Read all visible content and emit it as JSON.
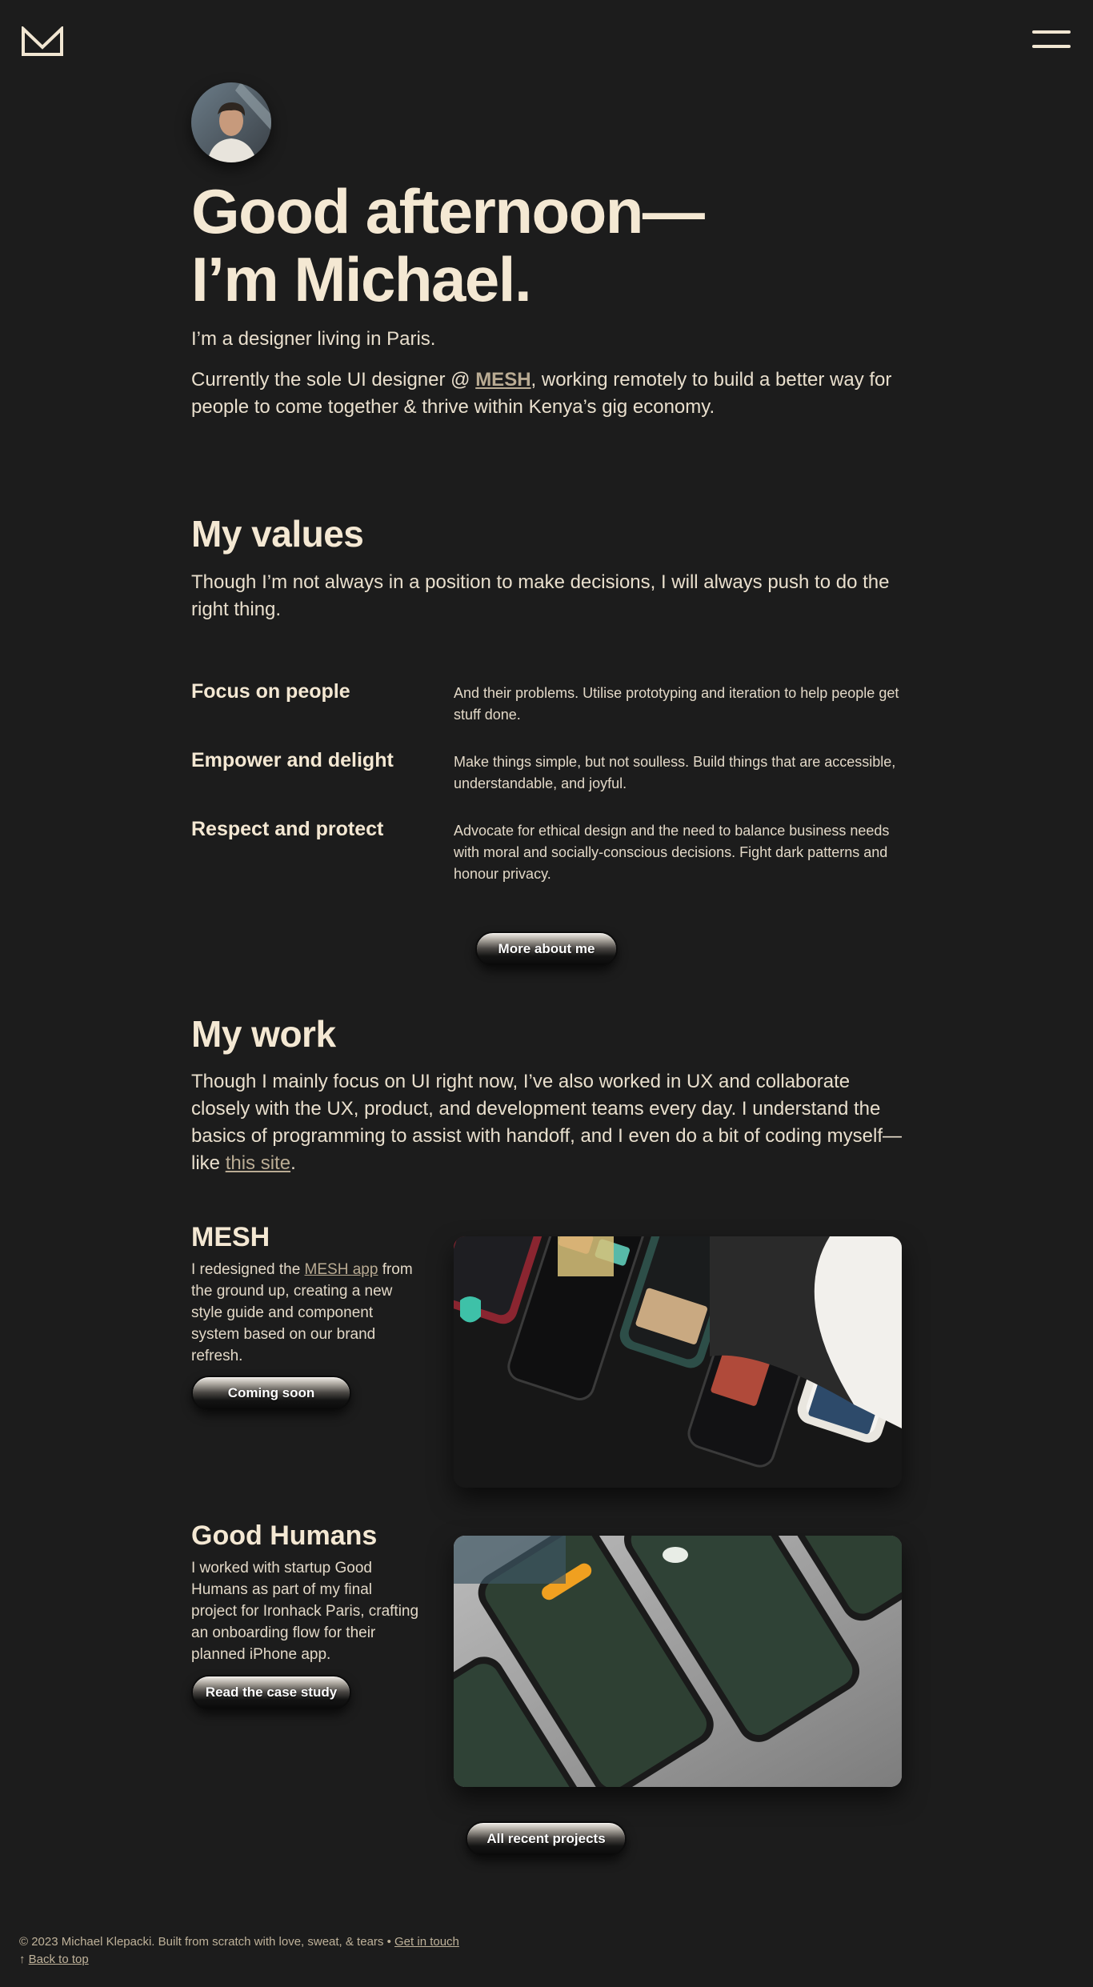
{
  "header": {
    "logo": "envelope-logo",
    "menu": "hamburger-icon"
  },
  "hero": {
    "title_line1": "Good afternoon—",
    "title_line2": "I’m Michael.",
    "intro": "I’m a designer living in Paris.",
    "current_prefix": "Currently the sole UI designer @ ",
    "current_link": "MESH",
    "current_suffix": ", working remotely to build a better way for people to come together & thrive within Kenya’s gig economy."
  },
  "values": {
    "heading": "My values",
    "lead": "Though I’m not always in a position to make decisions, I will always push to do the right thing.",
    "items": [
      {
        "title": "Focus on people",
        "desc": "And their problems. Utilise prototyping and iteration to help people get stuff done."
      },
      {
        "title": "Empower and delight",
        "desc": "Make things simple, but not soulless. Build things that are accessible, understandable, and joyful."
      },
      {
        "title": "Respect and protect",
        "desc": "Advocate for ethical design and the need to balance business needs with moral and socially-conscious decisions. Fight dark patterns and honour privacy."
      }
    ],
    "button": "More about me"
  },
  "work": {
    "heading": "My work",
    "lead_prefix": "Though I mainly focus on UI right now, I’ve also worked in UX and collaborate closely with the UX, product, and development teams every day. I understand the basics of programming to assist with handoff, and I even do a bit of coding myself—like ",
    "lead_link": "this site",
    "lead_suffix": ".",
    "projects": [
      {
        "title": "MESH",
        "desc_prefix": "I redesigned the ",
        "desc_link": "MESH app",
        "desc_suffix": " from the ground up, creating a new style guide and component system based on our brand refresh.",
        "button": "Coming soon"
      },
      {
        "title": "Good Humans",
        "desc": "I worked with startup Good Humans as part of my final project for Ironhack Paris, crafting an onboarding flow for their planned iPhone app.",
        "button": "Read the case study"
      }
    ],
    "all_button": "All recent projects"
  },
  "footer": {
    "copyright": "© 2023 Michael Klepacki. Built from scratch with love, sweat, & tears",
    "separator": "•",
    "contact": "Get in touch",
    "arrow": "↑",
    "back": "Back to top"
  },
  "colors": {
    "background": "#1c1c1c",
    "text": "#f1e6d2",
    "link": "#b9ab93"
  }
}
